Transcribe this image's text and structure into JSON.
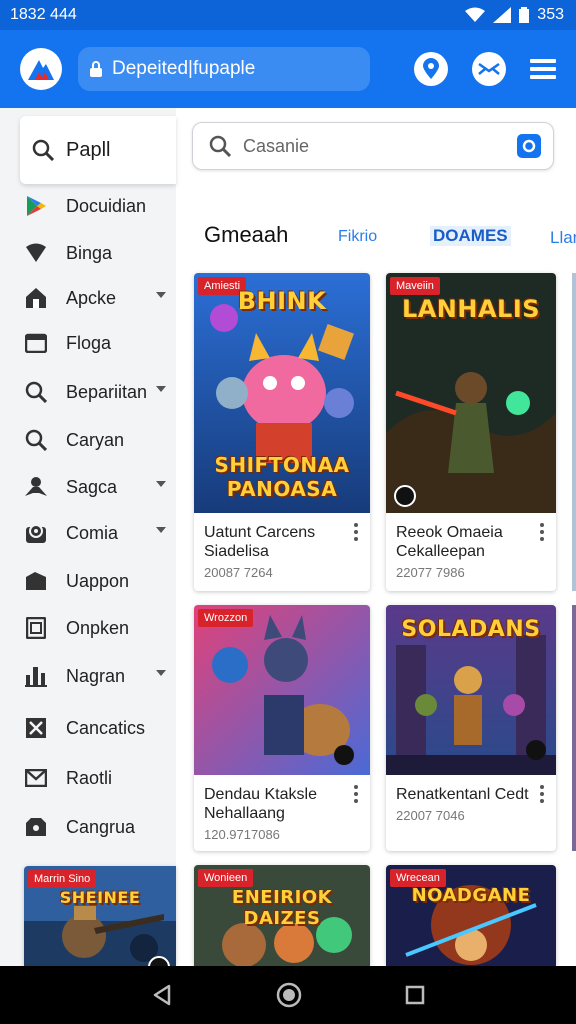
{
  "status": {
    "time": "1832 444",
    "battery": "353"
  },
  "header": {
    "url": "Depeited|fupaple"
  },
  "sidebar": {
    "search_label": "Papll",
    "items": [
      {
        "label": "Docuidian",
        "icon": "play-store-icon",
        "chevron": false
      },
      {
        "label": "Binga",
        "icon": "wifi-icon",
        "chevron": false
      },
      {
        "label": "Apcke",
        "icon": "apps-icon",
        "chevron": true
      },
      {
        "label": "Floga",
        "icon": "calendar-icon",
        "chevron": false
      },
      {
        "label": "Bepariitan",
        "icon": "search-icon",
        "chevron": true
      },
      {
        "label": "Caryan",
        "icon": "search-icon",
        "chevron": false
      },
      {
        "label": "Sagca",
        "icon": "user-icon",
        "chevron": true
      },
      {
        "label": "Comia",
        "icon": "location-icon",
        "chevron": true
      },
      {
        "label": "Uappon",
        "icon": "bag-icon",
        "chevron": false
      },
      {
        "label": "Onpken",
        "icon": "document-icon",
        "chevron": false
      },
      {
        "label": "Nagran",
        "icon": "bar-chart-icon",
        "chevron": true
      },
      {
        "label": "Cancatics",
        "icon": "close-box-icon",
        "chevron": false
      },
      {
        "label": "Raotli",
        "icon": "mail-icon",
        "chevron": false
      },
      {
        "label": "Cangrua",
        "icon": "folder-icon",
        "chevron": false
      }
    ]
  },
  "main": {
    "search_placeholder": "Casanie",
    "tabs": {
      "title": "Gmeaah",
      "tab_a": "Fikrio",
      "tab_b": "DOAMES",
      "tab_c": "Llan"
    },
    "cards": [
      {
        "badge": "Amiesti",
        "art_title_top": "BHINK",
        "art_title_bottom": "SHIFTONAA\nPANOASA",
        "title": "Uatunt Carcens Siadelisa",
        "meta": "20087 7264"
      },
      {
        "badge": "Maveiin",
        "art_title_top": "LANHALIS",
        "art_title_bottom": "",
        "title": "Reeok Omaeia Cekalleepan",
        "meta": "22077 7986"
      },
      {
        "badge": "Wrozzon",
        "art_title_top": "",
        "art_title_bottom": "",
        "title": "Dendau Ktaksle Nehallaang",
        "meta": "120.9717086"
      },
      {
        "badge": "",
        "art_title_top": "SOLADANS",
        "art_title_bottom": "",
        "title": "Renatkentanl Cedt",
        "meta": "22007 7046"
      },
      {
        "badge": "Marrin Sino",
        "art_title_top": "SHEINEE",
        "art_title_bottom": ""
      },
      {
        "badge": "Wonieen",
        "art_title_top": "ENEIRIOK DAIZES",
        "art_title_bottom": ""
      },
      {
        "badge": "Wrecean",
        "art_title_top": "NOADGANE",
        "art_title_bottom": ""
      }
    ]
  },
  "colors": {
    "primary": "#1473ee",
    "badge": "#d9232a"
  }
}
